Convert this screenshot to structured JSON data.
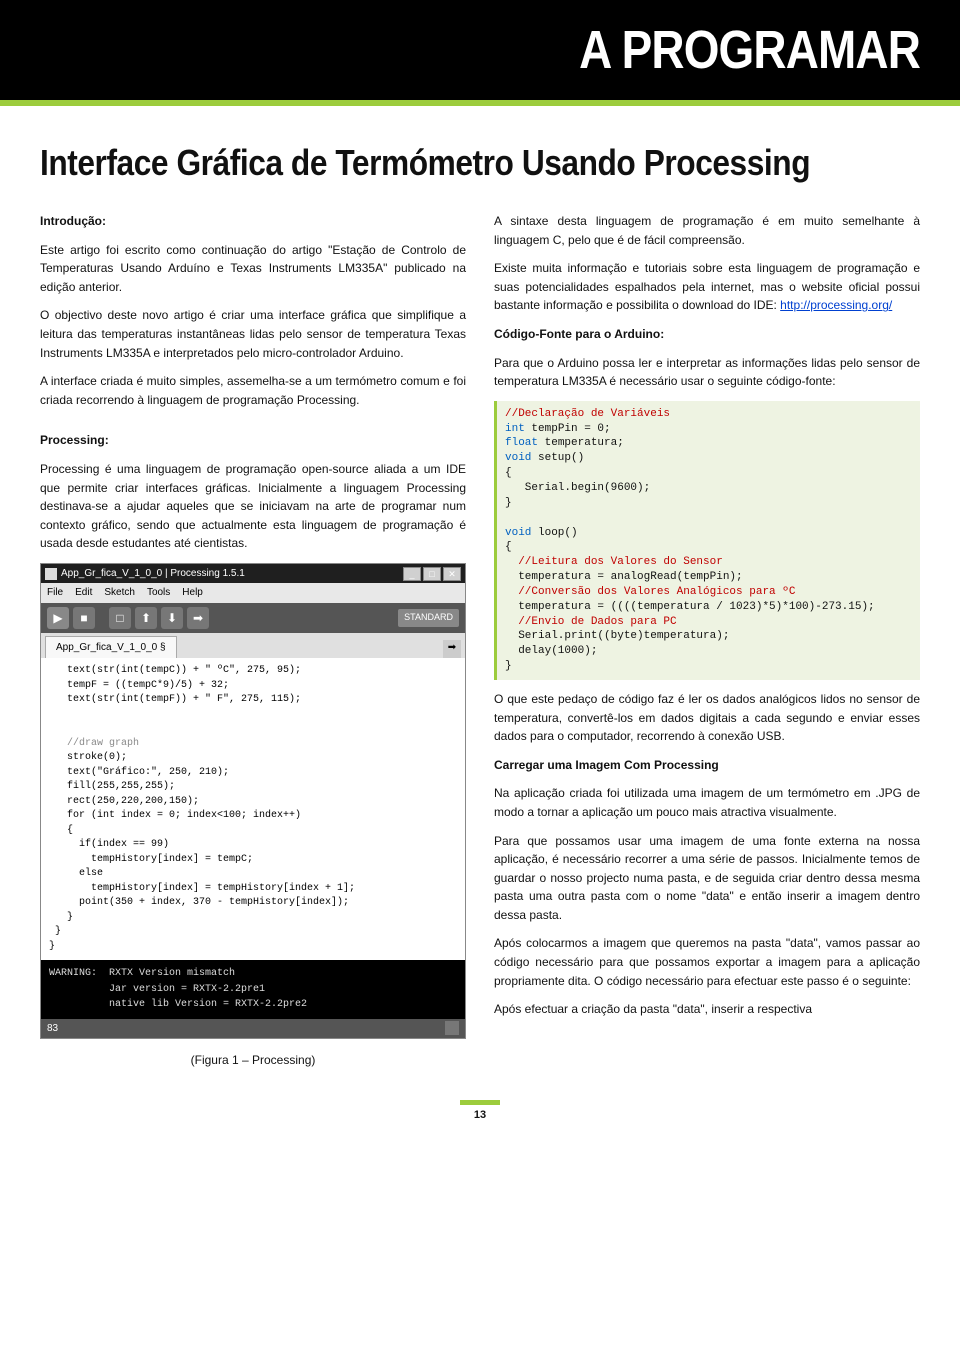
{
  "header": {
    "brand": "A PROGRAMAR"
  },
  "article": {
    "title": "Interface Gráfica de Termómetro Usando Processing"
  },
  "left": {
    "h_intro": "Introdução:",
    "p1": "Este artigo foi escrito como continuação do artigo \"Estação de Controlo de Temperaturas Usando Arduíno e Texas Instruments LM335A\" publicado na edição anterior.",
    "p2": "O objectivo deste novo artigo é criar uma interface gráfica que simplifique a leitura das temperaturas instantâneas lidas pelo sensor de temperatura Texas Instruments LM335A e interpretados pelo micro-controlador Arduino.",
    "p3": "A interface criada é muito simples, assemelha-se a um termómetro comum e foi criada recorrendo à linguagem de programação Processing.",
    "h_proc": "Processing:",
    "p4": "Processing é uma linguagem de programação open-source aliada a um IDE que permite criar interfaces gráficas. Inicialmente a linguagem Processing destinava-se a ajudar aqueles que se iniciavam na arte de programar num contexto gráfico, sendo que actualmente esta linguagem de programação é usada desde estudantes até cientistas.",
    "caption": "(Figura 1 – Processing)"
  },
  "right": {
    "p1": "A sintaxe desta linguagem de programação é em muito semelhante à linguagem C, pelo que é de fácil compreensão.",
    "p2a": "Existe muita informação e tutoriais sobre esta linguagem de programação e suas potencialidades espalhados pela internet, mas o website oficial possui bastante informação e possibilita o download do IDE: ",
    "p2_link": "http://processing.org/",
    "h_codigo": "Código-Fonte para o Arduino:",
    "p3": "Para que o Arduino possa ler e interpretar as informações lidas pelo sensor de temperatura LM335A é necessário usar o seguinte código-fonte:",
    "code": {
      "c1": "//Declaração de Variáveis",
      "l2a": "int",
      "l2b": " tempPin = 0;",
      "l3a": "float",
      "l3b": " temperatura;",
      "l4a": "void",
      "l4b": " setup()",
      "l5": "{",
      "l6": "   Serial.begin(9600);",
      "l7": "}",
      "l8": "",
      "l9a": "void",
      "l9b": " loop()",
      "l10": "{",
      "c11": "  //Leitura dos Valores do Sensor",
      "l12": "  temperatura = analogRead(tempPin);",
      "c13": "  //Conversão dos Valores Analógicos para ºC",
      "l14": "  temperatura = ((((temperatura / 1023)*5)*100)-273.15);",
      "c15": "  //Envio de Dados para PC",
      "l16": "  Serial.print((byte)temperatura);",
      "l17": "  delay(1000);",
      "l18": "}"
    },
    "p4": "O que este pedaço de código faz é ler os dados analógicos lidos no sensor de temperatura, convertê-los em dados digitais a cada segundo e enviar esses dados para o computador, recorrendo à conexão USB.",
    "h_img": "Carregar uma Imagem Com Processing",
    "p5": "Na aplicação criada foi utilizada uma imagem de um termómetro em .JPG de modo a tornar a aplicação um pouco mais atractiva visualmente.",
    "p6": "Para que possamos usar uma imagem de uma fonte externa na nossa aplicação, é necessário recorrer a uma série de passos. Inicialmente temos de guardar o nosso projecto numa pasta, e de seguida criar dentro dessa mesma pasta uma outra pasta com o nome \"data\" e então inserir a imagem dentro dessa pasta.",
    "p7": "Após colocarmos a imagem que queremos na pasta \"data\", vamos passar ao código necessário para que possamos exportar a imagem para a aplicação propriamente dita. O código necessário para efectuar este passo é o seguinte:",
    "p8": "Após efectuar a criação da pasta \"data\", inserir a respectiva"
  },
  "screenshot": {
    "title": "App_Gr_fica_V_1_0_0 | Processing 1.5.1",
    "menus": [
      "File",
      "Edit",
      "Sketch",
      "Tools",
      "Help"
    ],
    "standard": "STANDARD",
    "tab": "App_Gr_fica_V_1_0_0 §",
    "editor": {
      "l1": "   text(str(int(tempC)) + \" ºC\", 275, 95);",
      "l2": "   tempF = ((tempC*9)/5) + 32;",
      "l3": "   text(str(int(tempF)) + \" F\", 275, 115);",
      "l4": "",
      "l5": "",
      "l6": "   //draw graph",
      "l7": "   stroke(0);",
      "l8": "   text(\"Gráfico:\", 250, 210);",
      "l9": "   fill(255,255,255);",
      "l10": "   rect(250,220,200,150);",
      "l11": "   for (int index = 0; index<100; index++)",
      "l12": "   {",
      "l13": "     if(index == 99)",
      "l14": "       tempHistory[index] = tempC;",
      "l15": "     else",
      "l16": "       tempHistory[index] = tempHistory[index + 1];",
      "l17": "     point(350 + index, 370 - tempHistory[index]);",
      "l18": "   }",
      "l19": " }",
      "l20": "}"
    },
    "console": "WARNING:  RXTX Version mismatch\n          Jar version = RXTX-2.2pre1\n          native lib Version = RXTX-2.2pre2",
    "status_left": "83"
  },
  "page_number": "13"
}
